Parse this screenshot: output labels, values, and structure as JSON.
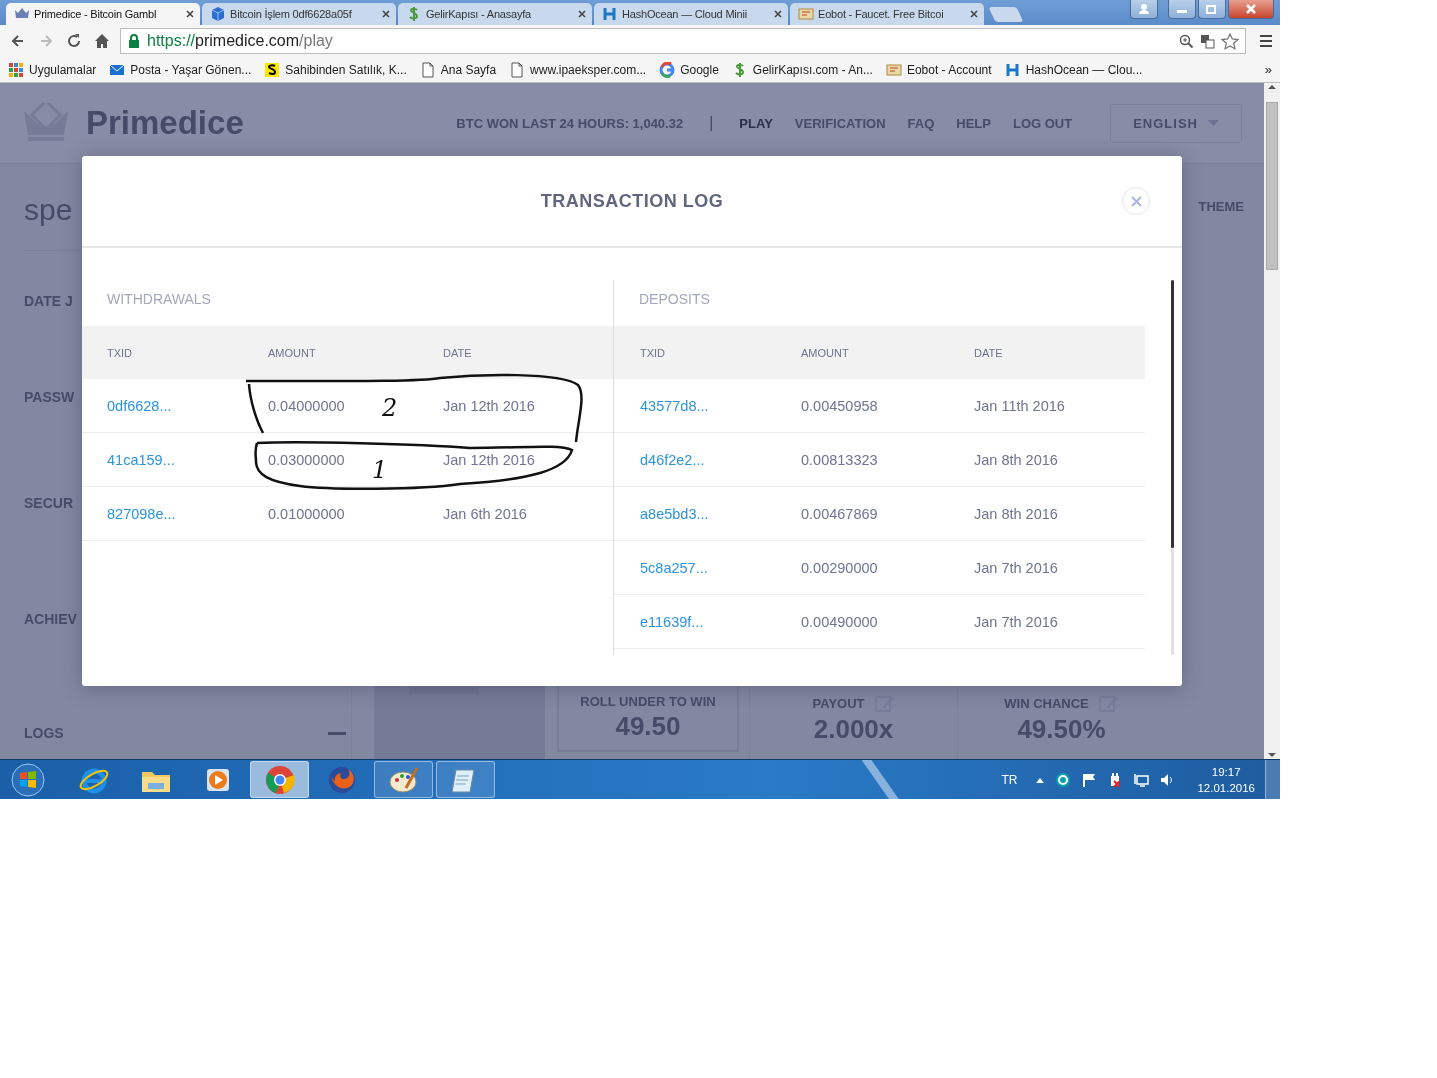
{
  "browser": {
    "tabs": [
      {
        "title": "Primedice - Bitcoin Gambl",
        "kind": "crown",
        "selected": true
      },
      {
        "title": "Bitcoin İşlem 0df6628a05f",
        "kind": "cube",
        "selected": false
      },
      {
        "title": "GelirKapısı - Anasayfa",
        "kind": "dollar",
        "selected": false
      },
      {
        "title": "HashOcean — Cloud Minii",
        "kind": "hash",
        "selected": false
      },
      {
        "title": "Eobot - Faucet. Free Bitcoi",
        "kind": "eobot",
        "selected": false
      }
    ],
    "address": {
      "scheme": "https://",
      "host": "primedice.com",
      "path": "/play"
    },
    "bookmarks": [
      {
        "label": "Uygulamalar",
        "kind": "apps"
      },
      {
        "label": "Posta - Yaşar Gönen...",
        "kind": "mail"
      },
      {
        "label": "Sahibinden Satılık, K...",
        "kind": "sahibinden"
      },
      {
        "label": "Ana Sayfa",
        "kind": "page"
      },
      {
        "label": "www.ipaeksper.com...",
        "kind": "page"
      },
      {
        "label": "Google",
        "kind": "google"
      },
      {
        "label": "GelirKapısı.com - An...",
        "kind": "dollar"
      },
      {
        "label": "Eobot - Account",
        "kind": "eobot"
      },
      {
        "label": "HashOcean — Clou...",
        "kind": "hash"
      }
    ],
    "bookmarks_more": "»"
  },
  "site": {
    "logo": "Primedice",
    "stats": "BTC WON LAST 24 HOURS: 1,040.32",
    "separator": "|",
    "nav": [
      {
        "label": "PLAY",
        "selected": true
      },
      {
        "label": "VERIFICATION",
        "selected": false
      },
      {
        "label": "FAQ",
        "selected": false
      },
      {
        "label": "HELP",
        "selected": false
      },
      {
        "label": "LOG OUT",
        "selected": false
      }
    ],
    "language": "ENGLISH",
    "profile": [
      "spe",
      "DATE J",
      "PASSW",
      "SECUR",
      "ACHIEV"
    ],
    "theme": "THEME",
    "logs": "LOGS",
    "bet": [
      {
        "label": "ROLL UNDER TO WIN",
        "value": "49.50",
        "kind": "boxed"
      },
      {
        "label": "PAYOUT",
        "value": "2.000x",
        "kind": "editable"
      },
      {
        "label": "WIN CHANCE",
        "value": "49.50%",
        "kind": "editable"
      }
    ]
  },
  "modal": {
    "title": "TRANSACTION LOG",
    "withdrawals": {
      "title": "WITHDRAWALS",
      "columns": [
        "TXID",
        "AMOUNT",
        "DATE"
      ],
      "rows": [
        [
          "0df6628...",
          "0.04000000",
          "Jan 12th 2016"
        ],
        [
          "41ca159...",
          "0.03000000",
          "Jan 12th 2016"
        ],
        [
          "827098e...",
          "0.01000000",
          "Jan 6th 2016"
        ]
      ]
    },
    "deposits": {
      "title": "DEPOSITS",
      "columns": [
        "TXID",
        "AMOUNT",
        "DATE"
      ],
      "rows": [
        [
          "43577d8...",
          "0.00450958",
          "Jan 11th 2016"
        ],
        [
          "d46f2e2...",
          "0.00813323",
          "Jan 8th 2016"
        ],
        [
          "a8e5bd3...",
          "0.00467869",
          "Jan 8th 2016"
        ],
        [
          "5c8a257...",
          "0.00290000",
          "Jan 7th 2016"
        ],
        [
          "e11639f...",
          "0.00490000",
          "Jan 7th 2016"
        ]
      ]
    }
  },
  "annotations": [
    {
      "mark": "2"
    },
    {
      "mark": "1"
    }
  ],
  "taskbar": {
    "apps": [
      {
        "kind": "ie",
        "open": false,
        "selected": false
      },
      {
        "kind": "explorer",
        "open": false,
        "selected": false
      },
      {
        "kind": "media",
        "open": false,
        "selected": false
      },
      {
        "kind": "chrome",
        "open": true,
        "selected": true
      },
      {
        "kind": "firefox",
        "open": false,
        "selected": false
      },
      {
        "kind": "paint",
        "open": true,
        "selected": false
      },
      {
        "kind": "notepad",
        "open": true,
        "selected": false
      }
    ],
    "language": "TR",
    "time": "19:17",
    "date": "12.01.2016"
  }
}
